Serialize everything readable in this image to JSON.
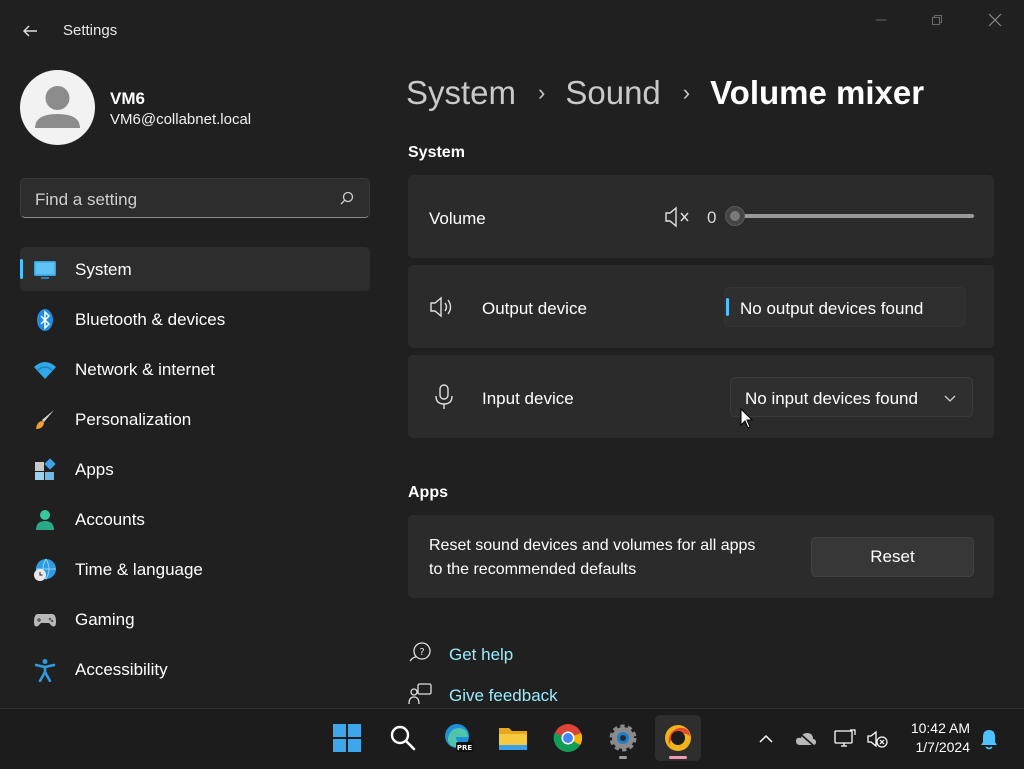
{
  "window": {
    "title": "Settings"
  },
  "profile": {
    "name": "VM6",
    "email": "VM6@collabnet.local"
  },
  "search": {
    "placeholder": "Find a setting"
  },
  "sidebar": {
    "items": [
      {
        "label": "System",
        "icon": "monitor-icon",
        "selected": true
      },
      {
        "label": "Bluetooth & devices",
        "icon": "bluetooth-icon"
      },
      {
        "label": "Network & internet",
        "icon": "wifi-icon"
      },
      {
        "label": "Personalization",
        "icon": "brush-icon"
      },
      {
        "label": "Apps",
        "icon": "apps-icon"
      },
      {
        "label": "Accounts",
        "icon": "accounts-icon"
      },
      {
        "label": "Time & language",
        "icon": "globe-clock-icon"
      },
      {
        "label": "Gaming",
        "icon": "gamepad-icon"
      },
      {
        "label": "Accessibility",
        "icon": "accessibility-icon"
      }
    ]
  },
  "breadcrumb": {
    "items": [
      "System",
      "Sound",
      "Volume mixer"
    ]
  },
  "system_section": {
    "title": "System",
    "volume": {
      "label": "Volume",
      "value": "0",
      "level": 0
    },
    "output": {
      "label": "Output device",
      "value": "No output devices found"
    },
    "input": {
      "label": "Input device",
      "value": "No input devices found"
    }
  },
  "apps_section": {
    "title": "Apps",
    "reset_text_line1": "Reset sound devices and volumes for all apps",
    "reset_text_line2": "to the recommended defaults",
    "reset_button": "Reset"
  },
  "links": {
    "help": "Get help",
    "feedback": "Give feedback"
  },
  "taskbar": {
    "apps": [
      "windows-start-icon",
      "search-icon",
      "edge-preview-icon",
      "file-explorer-icon",
      "chrome-icon",
      "settings-gear-icon",
      "app-icon"
    ],
    "time": "10:42 AM",
    "date": "1/7/2024"
  },
  "colors": {
    "accent": "#4cc2ff",
    "link": "#99ebff",
    "background": "#202020",
    "card": "#2b2b2b"
  }
}
